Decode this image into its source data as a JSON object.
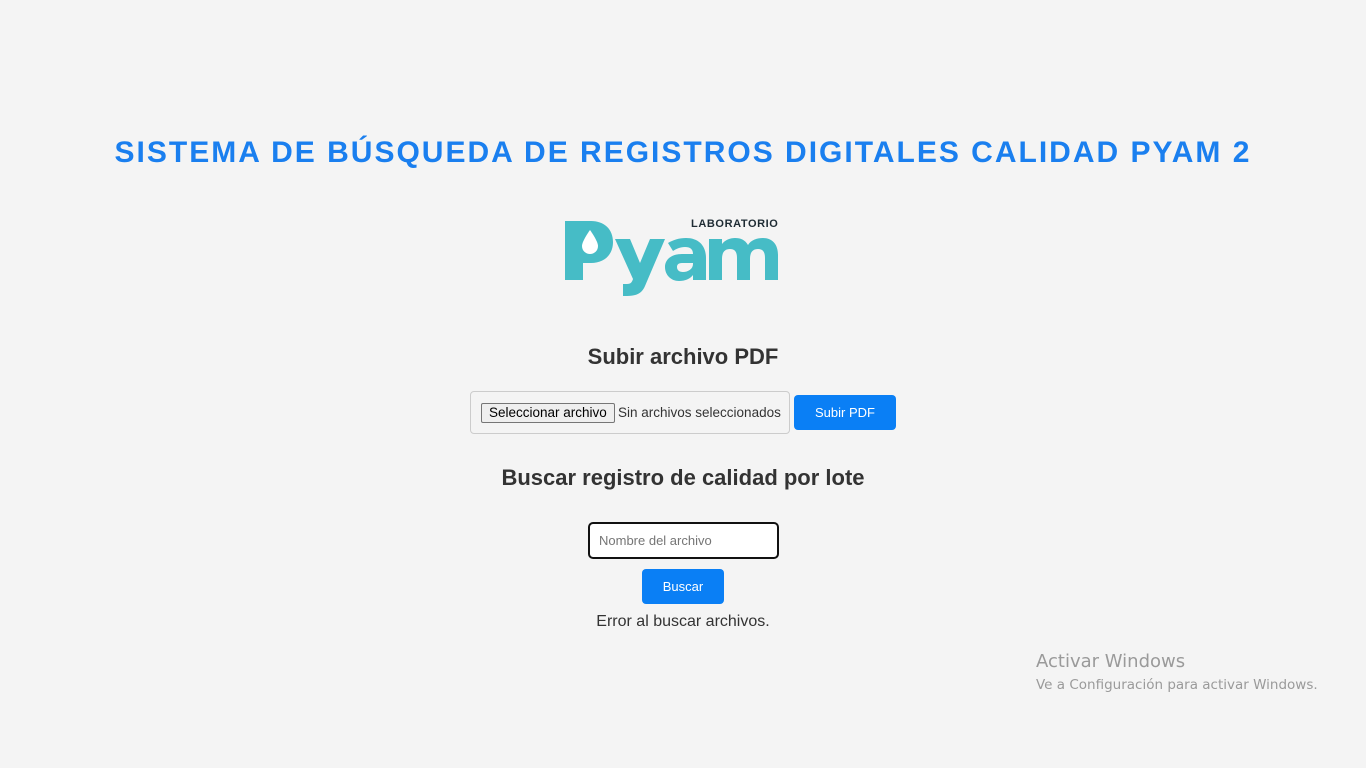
{
  "header": {
    "title": "SISTEMA DE BÚSQUEDA DE REGISTROS DIGITALES CALIDAD PYAM 2"
  },
  "logo": {
    "small_text": "LABORATORIO",
    "brand_text": "Pyam",
    "brand_color": "#46bcc6"
  },
  "upload": {
    "title": "Subir archivo PDF",
    "file_button_label": "Seleccionar archivo",
    "file_status": "Sin archivos seleccionados",
    "submit_label": "Subir PDF"
  },
  "search": {
    "title": "Buscar registro de calidad por lote",
    "input_placeholder": "Nombre del archivo",
    "input_value": "",
    "button_label": "Buscar",
    "result_message": "Error al buscar archivos."
  },
  "watermark": {
    "title": "Activar Windows",
    "subtitle": "Ve a Configuración para activar Windows."
  },
  "colors": {
    "accent": "#0a7ff5",
    "title": "#1a7fef",
    "background": "#f4f4f4"
  }
}
